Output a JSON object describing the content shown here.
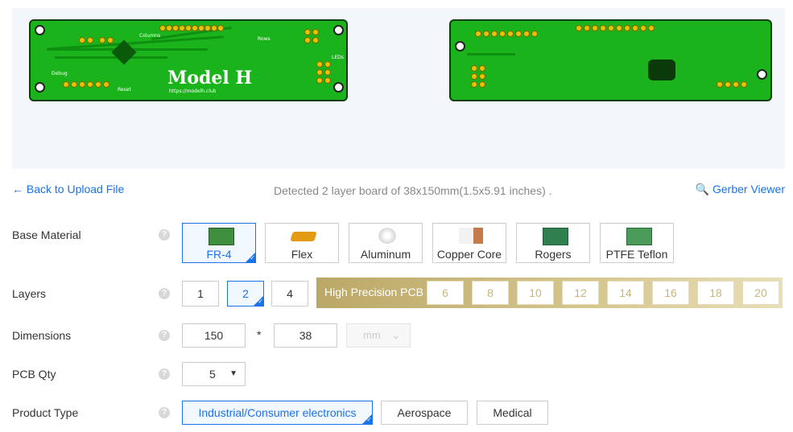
{
  "preview": {
    "front": {
      "title": "Model H",
      "url": "https://modelh.club",
      "labels": [
        "Columns",
        "Rows",
        "Debug",
        "Reset",
        "LEDs"
      ]
    },
    "colors": {
      "board": "#1bb31b",
      "pad": "#e6c200",
      "preview_bg": "#f3f6fb"
    }
  },
  "nav": {
    "back_label": "Back to Upload File",
    "detected_text": "Detected 2 layer board of 38x150mm(1.5x5.91 inches) .",
    "gerber_label": "Gerber Viewer"
  },
  "base_material": {
    "label": "Base Material",
    "options": [
      "FR-4",
      "Flex",
      "Aluminum",
      "Copper Core",
      "Rogers",
      "PTFE Teflon"
    ],
    "selected": "FR-4"
  },
  "layers": {
    "label": "Layers",
    "options": [
      "1",
      "2",
      "4"
    ],
    "selected": "2",
    "high_precision_label": "High Precision PCB",
    "high_precision_options": [
      "6",
      "8",
      "10",
      "12",
      "14",
      "16",
      "18",
      "20"
    ]
  },
  "dimensions": {
    "label": "Dimensions",
    "length": "150",
    "width": "38",
    "separator": "*",
    "unit": "mm"
  },
  "qty": {
    "label": "PCB Qty",
    "value": "5"
  },
  "product_type": {
    "label": "Product Type",
    "options": [
      "Industrial/Consumer electronics",
      "Aerospace",
      "Medical"
    ],
    "selected": "Industrial/Consumer electronics"
  },
  "accent_color": "#1a73e8"
}
